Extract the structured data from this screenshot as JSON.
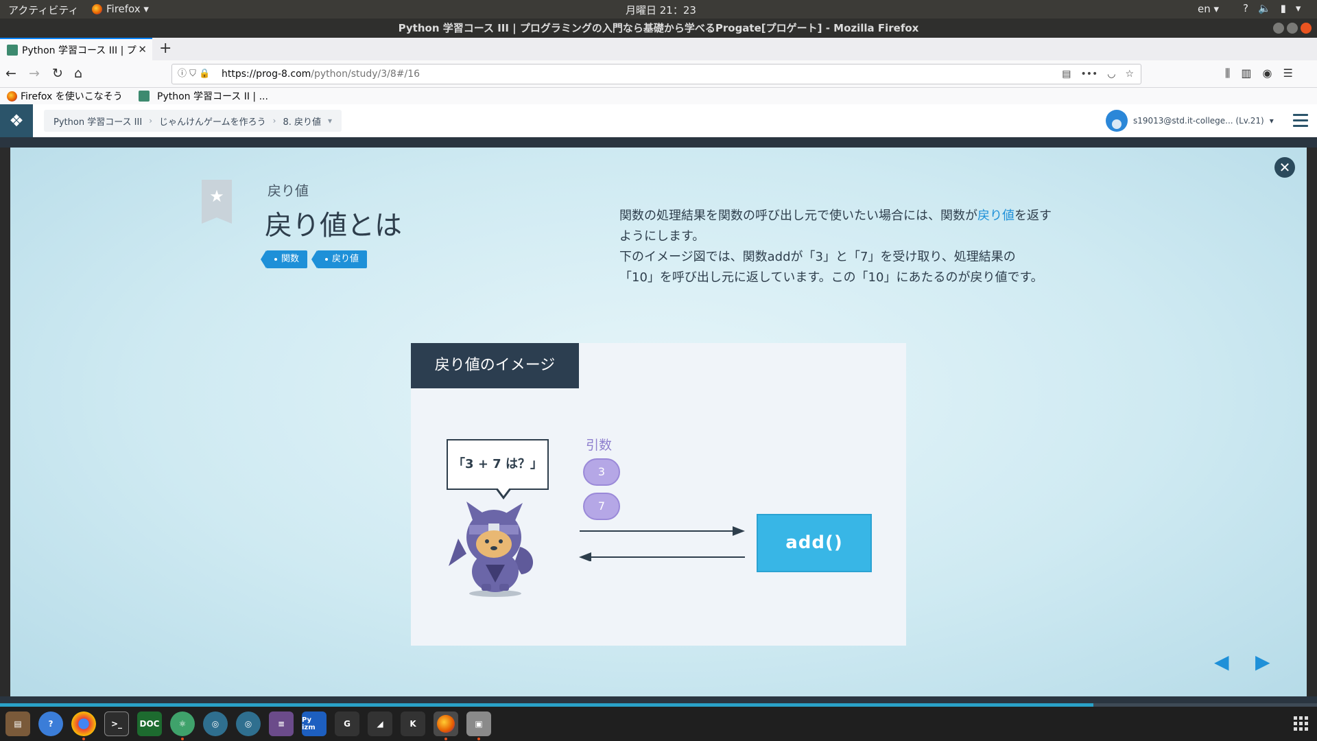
{
  "system_bar": {
    "activities": "アクティビティ",
    "app_menu": "Firefox ▾",
    "clock": "月曜日 21：23",
    "lang": "en ▾",
    "tray_icons": [
      "help-icon",
      "volume-icon",
      "battery-icon",
      "chevron-down-icon"
    ]
  },
  "window": {
    "title": "Python 学習コース III | プログラミングの入門なら基礎から学べるProgate[プロゲート] - Mozilla Firefox"
  },
  "browser": {
    "tab_title": "Python 学習コース III | プ",
    "url_host": "https://prog-8.com",
    "url_path": "/python/study/3/8#/16",
    "bookmarks": [
      {
        "label": "Firefox を使いこなそう"
      },
      {
        "label": "Python 学習コース II | ..."
      }
    ]
  },
  "app_header": {
    "breadcrumb": [
      "Python 学習コース III",
      "じゃんけんゲームを作ろう",
      "8. 戻り値"
    ],
    "user": "s19013@std.it-college... (Lv.21)"
  },
  "slide": {
    "subtitle": "戻り値",
    "title": "戻り値とは",
    "tags": [
      "関数",
      "戻り値"
    ],
    "description": {
      "line1_a": "関数の処理結果を関数の呼び出し元で使いたい場合には、関数が",
      "line1_hl": "戻り値",
      "line1_b": "を返す",
      "line2": "ようにします。",
      "line3": "下のイメージ図では、関数addが「3」と「7」を受け取り、処理結果の",
      "line4": "「10」を呼び出し元に返しています。この「10」にあたるのが戻り値です。"
    },
    "figure": {
      "title": "戻り値のイメージ",
      "bubble": "「3 + 7 は？」",
      "arg_label": "引数",
      "args": [
        "3",
        "7"
      ],
      "function_box": "add()"
    },
    "progress": 0.83
  },
  "colors": {
    "accent": "#1e90d8",
    "figure_header": "#2c3e50",
    "function_box": "#38b6e6",
    "argument": "#b5a7e6"
  },
  "dock": {
    "icons": [
      "files-icon",
      "help-icon",
      "chrome-icon",
      "terminal-icon",
      "doc-icon",
      "atom-icon",
      "browser-icon",
      "browser-icon",
      "text-editor-icon",
      "pyzm-icon",
      "g-icon",
      "pen-icon",
      "k-icon",
      "firefox-icon",
      "screenshot-icon"
    ],
    "labels": {
      "doc": "DOC",
      "pyzm": "Py\nizm",
      "g": "G",
      "k": "K"
    }
  }
}
